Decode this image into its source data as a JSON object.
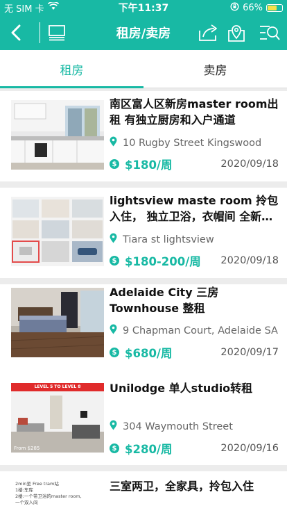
{
  "status": {
    "carrier": "无 SIM 卡",
    "time": "下午11:37",
    "battery": "66%",
    "battery_level": 0.66
  },
  "nav": {
    "title": "租房/卖房"
  },
  "tabs": [
    {
      "label": "租房",
      "active": true
    },
    {
      "label": "卖房",
      "active": false
    }
  ],
  "listings": [
    {
      "title": "南区富人区新房master room出租 有独立厨房和入户通道",
      "address": "10 Rugby Street Kingswood",
      "price": "$180/周",
      "date": "2020/09/18"
    },
    {
      "title": "lightsview maste room 拎包入住， 独立卫浴，衣帽间 全新房子，交通...",
      "address": "Tiara st lightsview",
      "price": "$180-200/周",
      "date": "2020/09/18"
    },
    {
      "title": "Adelaide City 三房 Townhouse 整租",
      "address": "9 Chapman Court, Adelaide SA",
      "price": "$680/周",
      "date": "2020/09/17"
    },
    {
      "title": "Unilodge 单人studio转租",
      "address": "304 Waymouth Street",
      "price": "$280/周",
      "date": "2020/09/16",
      "thumb_banner": "LEVEL 5 TO LEVEL 8",
      "thumb_caption": "From $285"
    },
    {
      "title": "三室两卫，全家具，拎包入住",
      "address": "",
      "price": "",
      "date": "",
      "thumb_lines": [
        "2min至 Free tram站",
        "1楼:车库",
        "2楼:一个带卫浴的master room,",
        "一个双人间"
      ]
    }
  ],
  "colors": {
    "accent": "#18b9a4",
    "background": "#ececec"
  }
}
